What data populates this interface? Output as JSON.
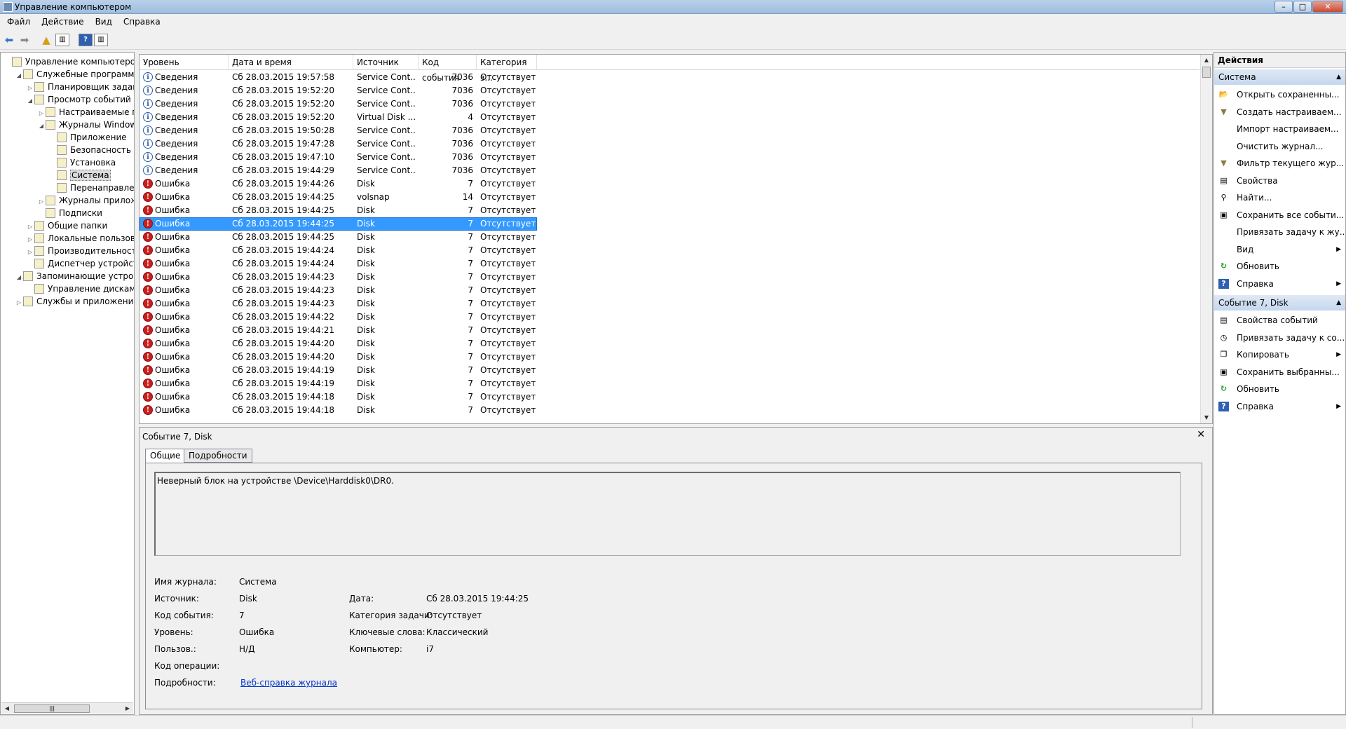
{
  "window": {
    "title": "Управление компьютером"
  },
  "menu": [
    "Файл",
    "Действие",
    "Вид",
    "Справка"
  ],
  "tree": [
    {
      "label": "Управление компьютером (л",
      "indent": 0,
      "exp": "",
      "icon": "computer-management-icon"
    },
    {
      "label": "Служебные программы",
      "indent": 1,
      "exp": "◢",
      "icon": "tools-icon"
    },
    {
      "label": "Планировщик заданий",
      "indent": 2,
      "exp": "▷",
      "icon": "clock-icon"
    },
    {
      "label": "Просмотр событий",
      "indent": 2,
      "exp": "◢",
      "icon": "event-viewer-icon"
    },
    {
      "label": "Настраиваемые пр",
      "indent": 3,
      "exp": "▷",
      "icon": "folder-icon"
    },
    {
      "label": "Журналы Windows",
      "indent": 3,
      "exp": "◢",
      "icon": "folder-icon"
    },
    {
      "label": "Приложение",
      "indent": 4,
      "exp": "",
      "icon": "log-icon"
    },
    {
      "label": "Безопасность",
      "indent": 4,
      "exp": "",
      "icon": "log-icon"
    },
    {
      "label": "Установка",
      "indent": 4,
      "exp": "",
      "icon": "log-icon"
    },
    {
      "label": "Система",
      "indent": 4,
      "exp": "",
      "icon": "log-icon",
      "selected": true
    },
    {
      "label": "Перенаправлен",
      "indent": 4,
      "exp": "",
      "icon": "log-icon"
    },
    {
      "label": "Журналы приложе",
      "indent": 3,
      "exp": "▷",
      "icon": "folder-icon"
    },
    {
      "label": "Подписки",
      "indent": 3,
      "exp": "",
      "icon": "log-icon"
    },
    {
      "label": "Общие папки",
      "indent": 2,
      "exp": "▷",
      "icon": "shared-folder-icon"
    },
    {
      "label": "Локальные пользовате",
      "indent": 2,
      "exp": "▷",
      "icon": "users-icon"
    },
    {
      "label": "Производительность",
      "indent": 2,
      "exp": "▷",
      "icon": "performance-icon"
    },
    {
      "label": "Диспетчер устройств",
      "indent": 2,
      "exp": "",
      "icon": "device-manager-icon"
    },
    {
      "label": "Запоминающие устройст",
      "indent": 1,
      "exp": "◢",
      "icon": "storage-icon"
    },
    {
      "label": "Управление дисками",
      "indent": 2,
      "exp": "",
      "icon": "disk-icon"
    },
    {
      "label": "Службы и приложения",
      "indent": 1,
      "exp": "▷",
      "icon": "services-icon"
    }
  ],
  "columns": [
    "Уровень",
    "Дата и время",
    "Источник",
    "Код события",
    "Категория з..."
  ],
  "events": [
    {
      "level": "Сведения",
      "type": "info",
      "date": "Сб 28.03.2015 19:57:58",
      "source": "Service Cont...",
      "id": "7036",
      "cat": "Отсутствует"
    },
    {
      "level": "Сведения",
      "type": "info",
      "date": "Сб 28.03.2015 19:52:20",
      "source": "Service Cont...",
      "id": "7036",
      "cat": "Отсутствует"
    },
    {
      "level": "Сведения",
      "type": "info",
      "date": "Сб 28.03.2015 19:52:20",
      "source": "Service Cont...",
      "id": "7036",
      "cat": "Отсутствует"
    },
    {
      "level": "Сведения",
      "type": "info",
      "date": "Сб 28.03.2015 19:52:20",
      "source": "Virtual Disk ...",
      "id": "4",
      "cat": "Отсутствует"
    },
    {
      "level": "Сведения",
      "type": "info",
      "date": "Сб 28.03.2015 19:50:28",
      "source": "Service Cont...",
      "id": "7036",
      "cat": "Отсутствует"
    },
    {
      "level": "Сведения",
      "type": "info",
      "date": "Сб 28.03.2015 19:47:28",
      "source": "Service Cont...",
      "id": "7036",
      "cat": "Отсутствует"
    },
    {
      "level": "Сведения",
      "type": "info",
      "date": "Сб 28.03.2015 19:47:10",
      "source": "Service Cont...",
      "id": "7036",
      "cat": "Отсутствует"
    },
    {
      "level": "Сведения",
      "type": "info",
      "date": "Сб 28.03.2015 19:44:29",
      "source": "Service Cont...",
      "id": "7036",
      "cat": "Отсутствует"
    },
    {
      "level": "Ошибка",
      "type": "err",
      "date": "Сб 28.03.2015 19:44:26",
      "source": "Disk",
      "id": "7",
      "cat": "Отсутствует"
    },
    {
      "level": "Ошибка",
      "type": "err",
      "date": "Сб 28.03.2015 19:44:25",
      "source": "volsnap",
      "id": "14",
      "cat": "Отсутствует"
    },
    {
      "level": "Ошибка",
      "type": "err",
      "date": "Сб 28.03.2015 19:44:25",
      "source": "Disk",
      "id": "7",
      "cat": "Отсутствует"
    },
    {
      "level": "Ошибка",
      "type": "err",
      "date": "Сб 28.03.2015 19:44:25",
      "source": "Disk",
      "id": "7",
      "cat": "Отсутствует",
      "selected": true
    },
    {
      "level": "Ошибка",
      "type": "err",
      "date": "Сб 28.03.2015 19:44:25",
      "source": "Disk",
      "id": "7",
      "cat": "Отсутствует"
    },
    {
      "level": "Ошибка",
      "type": "err",
      "date": "Сб 28.03.2015 19:44:24",
      "source": "Disk",
      "id": "7",
      "cat": "Отсутствует"
    },
    {
      "level": "Ошибка",
      "type": "err",
      "date": "Сб 28.03.2015 19:44:24",
      "source": "Disk",
      "id": "7",
      "cat": "Отсутствует"
    },
    {
      "level": "Ошибка",
      "type": "err",
      "date": "Сб 28.03.2015 19:44:23",
      "source": "Disk",
      "id": "7",
      "cat": "Отсутствует"
    },
    {
      "level": "Ошибка",
      "type": "err",
      "date": "Сб 28.03.2015 19:44:23",
      "source": "Disk",
      "id": "7",
      "cat": "Отсутствует"
    },
    {
      "level": "Ошибка",
      "type": "err",
      "date": "Сб 28.03.2015 19:44:23",
      "source": "Disk",
      "id": "7",
      "cat": "Отсутствует"
    },
    {
      "level": "Ошибка",
      "type": "err",
      "date": "Сб 28.03.2015 19:44:22",
      "source": "Disk",
      "id": "7",
      "cat": "Отсутствует"
    },
    {
      "level": "Ошибка",
      "type": "err",
      "date": "Сб 28.03.2015 19:44:21",
      "source": "Disk",
      "id": "7",
      "cat": "Отсутствует"
    },
    {
      "level": "Ошибка",
      "type": "err",
      "date": "Сб 28.03.2015 19:44:20",
      "source": "Disk",
      "id": "7",
      "cat": "Отсутствует"
    },
    {
      "level": "Ошибка",
      "type": "err",
      "date": "Сб 28.03.2015 19:44:20",
      "source": "Disk",
      "id": "7",
      "cat": "Отсутствует"
    },
    {
      "level": "Ошибка",
      "type": "err",
      "date": "Сб 28.03.2015 19:44:19",
      "source": "Disk",
      "id": "7",
      "cat": "Отсутствует"
    },
    {
      "level": "Ошибка",
      "type": "err",
      "date": "Сб 28.03.2015 19:44:19",
      "source": "Disk",
      "id": "7",
      "cat": "Отсутствует"
    },
    {
      "level": "Ошибка",
      "type": "err",
      "date": "Сб 28.03.2015 19:44:18",
      "source": "Disk",
      "id": "7",
      "cat": "Отсутствует"
    },
    {
      "level": "Ошибка",
      "type": "err",
      "date": "Сб 28.03.2015 19:44:18",
      "source": "Disk",
      "id": "7",
      "cat": "Отсутствует"
    }
  ],
  "detail": {
    "title": "Событие 7, Disk",
    "tabs": [
      "Общие",
      "Подробности"
    ],
    "message": "Неверный блок на устройстве \\Device\\Harddisk0\\DR0.",
    "labels": {
      "log": "Имя журнала:",
      "source": "Источник:",
      "event_id": "Код события:",
      "level": "Уровень:",
      "user": "Пользов.:",
      "opcode": "Код операции:",
      "more": "Подробности:",
      "date": "Дата:",
      "task": "Категория задачи:",
      "keywords": "Ключевые слова:",
      "computer": "Компьютер:"
    },
    "values": {
      "log": "Система",
      "source": "Disk",
      "event_id": "7",
      "level": "Ошибка",
      "user": "Н/Д",
      "date": "Сб 28.03.2015 19:44:25",
      "task": "Отсутствует",
      "keywords": "Классический",
      "computer": "i7",
      "more_link": "Веб-справка журнала"
    }
  },
  "actions": {
    "header": "Действия",
    "section1": "Система",
    "items1": [
      {
        "label": "Открыть сохраненны...",
        "icon": "open-folder-icon",
        "glyph": "📂",
        "sub": false
      },
      {
        "label": "Создать настраиваем...",
        "icon": "filter-create-icon",
        "glyph": "▼",
        "sub": false
      },
      {
        "label": "Импорт настраиваем...",
        "icon": "",
        "glyph": "",
        "sub": false
      },
      {
        "label": "Очистить журнал...",
        "icon": "",
        "glyph": "",
        "sub": false
      },
      {
        "label": "Фильтр текущего жур...",
        "icon": "filter-icon",
        "glyph": "▼",
        "sub": false
      },
      {
        "label": "Свойства",
        "icon": "properties-icon",
        "glyph": "▤",
        "sub": false
      },
      {
        "label": "Найти...",
        "icon": "find-icon",
        "glyph": "⚲",
        "sub": false
      },
      {
        "label": "Сохранить все событи...",
        "icon": "save-icon",
        "glyph": "▣",
        "sub": false
      },
      {
        "label": "Привязать задачу к жу...",
        "icon": "",
        "glyph": "",
        "sub": false
      },
      {
        "label": "Вид",
        "icon": "",
        "glyph": "",
        "sub": true
      },
      {
        "label": "Обновить",
        "icon": "refresh-icon",
        "glyph": "↻",
        "sub": false
      },
      {
        "label": "Справка",
        "icon": "help-icon",
        "glyph": "?",
        "sub": true
      }
    ],
    "section2": "Событие 7, Disk",
    "items2": [
      {
        "label": "Свойства событий",
        "icon": "event-properties-icon",
        "glyph": "▤",
        "sub": false
      },
      {
        "label": "Привязать задачу к со...",
        "icon": "attach-task-icon",
        "glyph": "◷",
        "sub": false
      },
      {
        "label": "Копировать",
        "icon": "copy-icon",
        "glyph": "❐",
        "sub": true
      },
      {
        "label": "Сохранить выбранны...",
        "icon": "save-icon",
        "glyph": "▣",
        "sub": false
      },
      {
        "label": "Обновить",
        "icon": "refresh-icon",
        "glyph": "↻",
        "sub": false
      },
      {
        "label": "Справка",
        "icon": "help-icon",
        "glyph": "?",
        "sub": true
      }
    ]
  }
}
